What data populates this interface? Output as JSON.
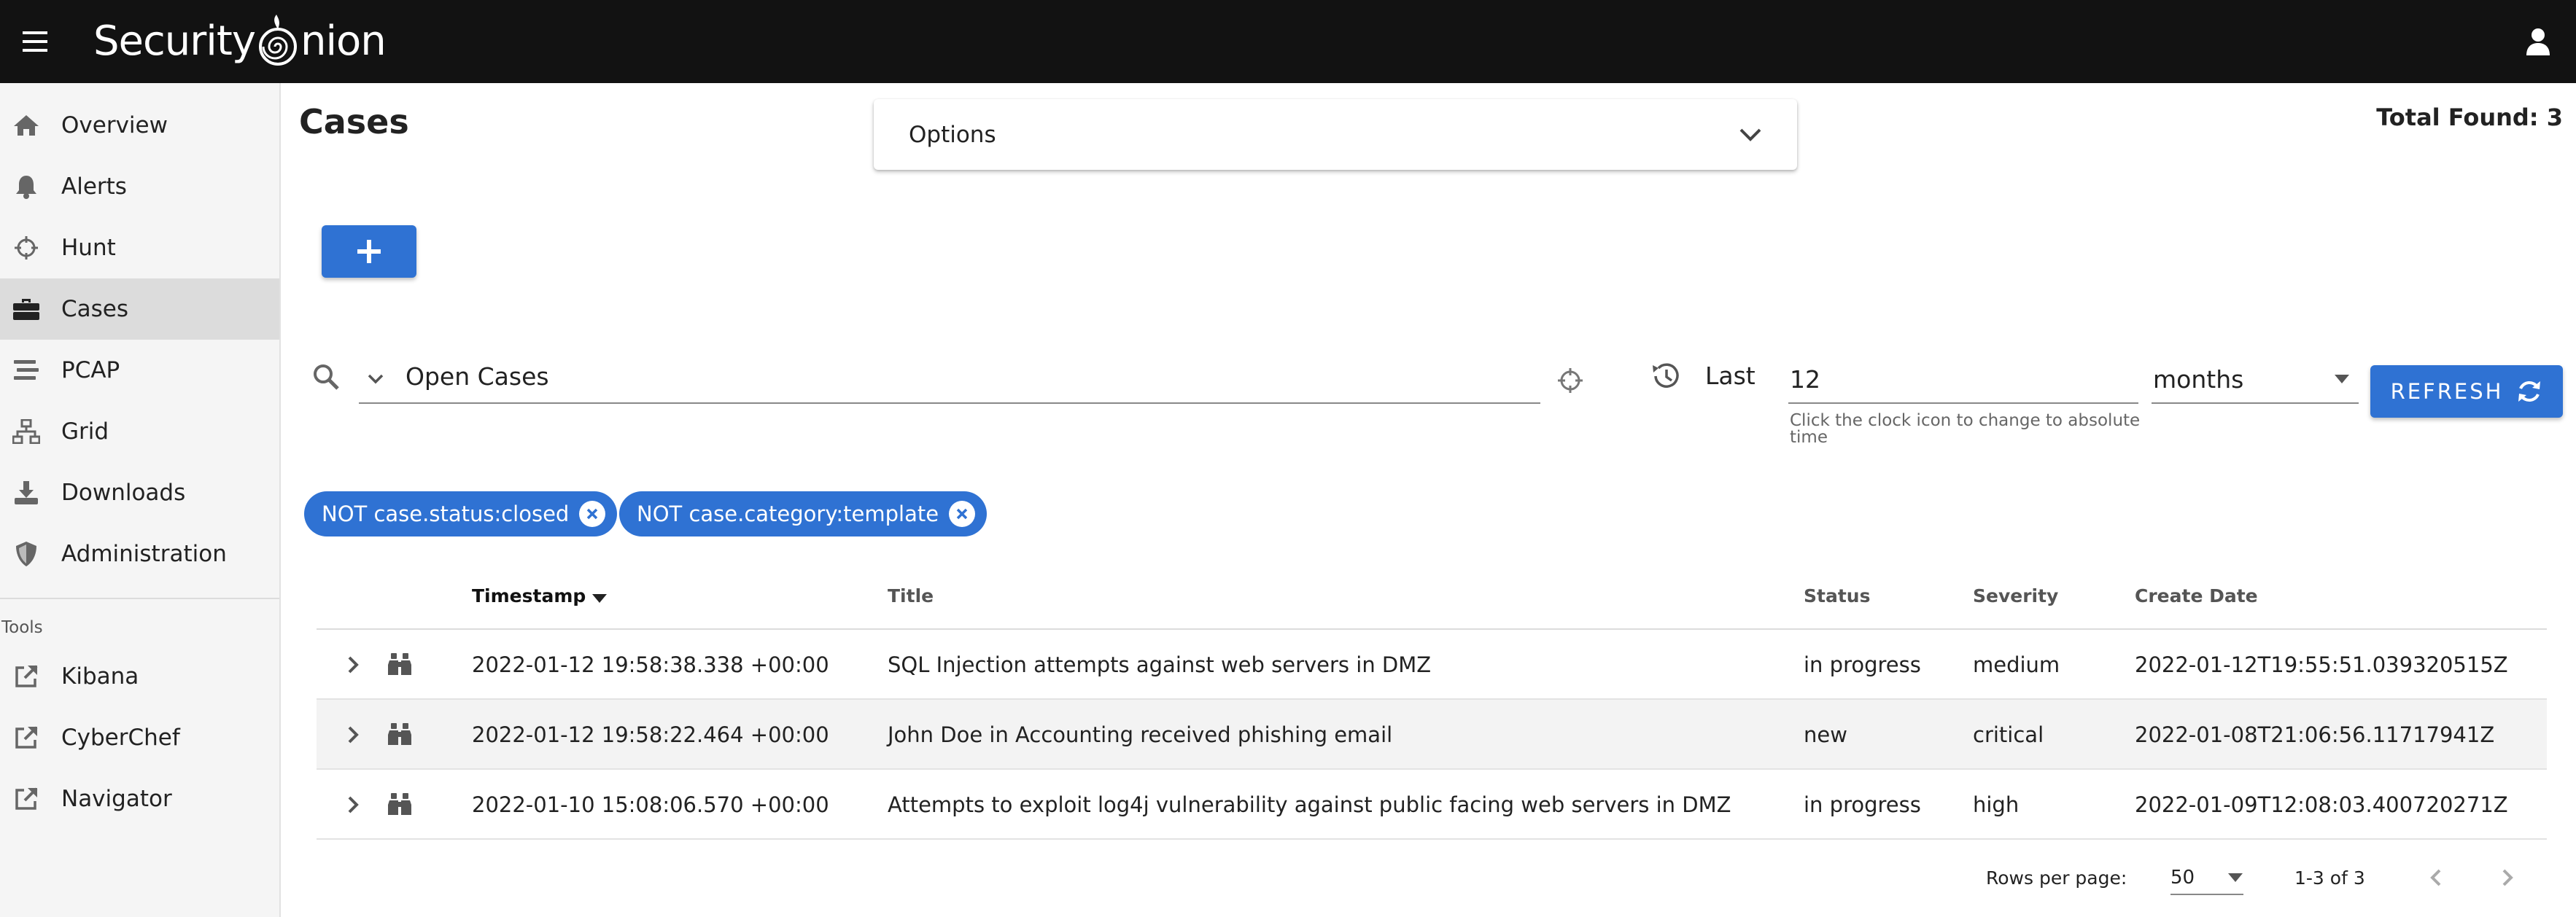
{
  "brand": {
    "left": "Security",
    "right": "nion"
  },
  "sidebar": {
    "items": [
      {
        "label": "Overview",
        "icon": "home-icon",
        "active": false
      },
      {
        "label": "Alerts",
        "icon": "bell-icon",
        "active": false
      },
      {
        "label": "Hunt",
        "icon": "crosshairs-icon",
        "active": false
      },
      {
        "label": "Cases",
        "icon": "briefcase-icon",
        "active": true
      },
      {
        "label": "PCAP",
        "icon": "stream-icon",
        "active": false
      },
      {
        "label": "Grid",
        "icon": "sitemap-icon",
        "active": false
      },
      {
        "label": "Downloads",
        "icon": "download-icon",
        "active": false
      },
      {
        "label": "Administration",
        "icon": "shield-icon",
        "active": false
      }
    ],
    "tools_title": "Tools",
    "tools": [
      {
        "label": "Kibana",
        "icon": "external-link-icon"
      },
      {
        "label": "CyberChef",
        "icon": "external-link-icon"
      },
      {
        "label": "Navigator",
        "icon": "external-link-icon"
      }
    ]
  },
  "main": {
    "title": "Cases",
    "options_label": "Options",
    "total_found": "Total Found: 3",
    "add_label": "+",
    "query": "Open Cases",
    "last_label": "Last",
    "last_value": "12",
    "last_hint": "Click the clock icon to change to absolute time",
    "unit": "months",
    "refresh_label": "REFRESH",
    "chips": [
      "NOT case.status:closed",
      "NOT case.category:template"
    ]
  },
  "table": {
    "columns": [
      "Timestamp",
      "Title",
      "Status",
      "Severity",
      "Create Date"
    ],
    "rows": [
      {
        "timestamp": "2022-01-12 19:58:38.338 +00:00",
        "title": "SQL Injection attempts against web servers in DMZ",
        "status": "in progress",
        "severity": "medium",
        "create_date": "2022-01-12T19:55:51.039320515Z"
      },
      {
        "timestamp": "2022-01-12 19:58:22.464 +00:00",
        "title": "John Doe in Accounting received phishing email",
        "status": "new",
        "severity": "critical",
        "create_date": "2022-01-08T21:06:56.11717941Z"
      },
      {
        "timestamp": "2022-01-10 15:08:06.570 +00:00",
        "title": "Attempts to exploit log4j vulnerability against public facing web servers in DMZ",
        "status": "in progress",
        "severity": "high",
        "create_date": "2022-01-09T12:08:03.400720271Z"
      }
    ],
    "footer": {
      "rows_per_page_label": "Rows per page:",
      "rows_per_page": "50",
      "range": "1-3 of 3"
    }
  },
  "colors": {
    "appbar": "#121212",
    "accent": "#2f72d3",
    "sidebar_bg": "#f5f5f5",
    "active_item": "#dcdcdc"
  }
}
